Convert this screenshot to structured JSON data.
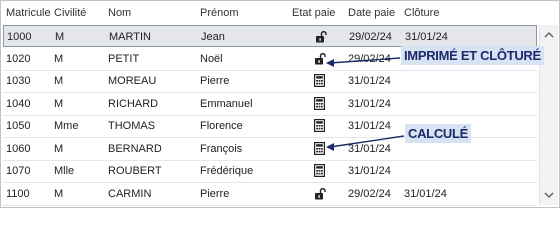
{
  "columns": {
    "matricule": "Matricule",
    "civilite": "Civilité",
    "nom": "Nom",
    "prenom": "Prénom",
    "etat_paie": "Etat paie",
    "date_paie": "Date paie",
    "cloture": "Clôture"
  },
  "rows": [
    {
      "matricule": "1000",
      "civilite": "M",
      "nom": "MARTIN",
      "prenom": "Jean",
      "etat": "lock-icon",
      "date_paie": "29/02/24",
      "cloture": "31/01/24",
      "selected": true
    },
    {
      "matricule": "1020",
      "civilite": "M",
      "nom": "PETIT",
      "prenom": "Noël",
      "etat": "lock-icon",
      "date_paie": "29/02/24",
      "cloture": ""
    },
    {
      "matricule": "1030",
      "civilite": "M",
      "nom": "MOREAU",
      "prenom": "Pierre",
      "etat": "calculator-icon",
      "date_paie": "31/01/24",
      "cloture": ""
    },
    {
      "matricule": "1040",
      "civilite": "M",
      "nom": "RICHARD",
      "prenom": "Emmanuel",
      "etat": "calculator-icon",
      "date_paie": "31/01/24",
      "cloture": ""
    },
    {
      "matricule": "1050",
      "civilite": "Mme",
      "nom": "THOMAS",
      "prenom": "Florence",
      "etat": "calculator-icon",
      "date_paie": "31/01/24",
      "cloture": ""
    },
    {
      "matricule": "1060",
      "civilite": "M",
      "nom": "BERNARD",
      "prenom": "François",
      "etat": "calculator-icon",
      "date_paie": "31/01/24",
      "cloture": ""
    },
    {
      "matricule": "1070",
      "civilite": "Mlle",
      "nom": "ROUBERT",
      "prenom": "Frédérique",
      "etat": "calculator-icon",
      "date_paie": "31/01/24",
      "cloture": ""
    },
    {
      "matricule": "1100",
      "civilite": "M",
      "nom": "CARMIN",
      "prenom": "Pierre",
      "etat": "lock-icon",
      "date_paie": "29/02/24",
      "cloture": "31/01/24"
    }
  ],
  "annotations": {
    "printed_closed": "IMPRIMÉ ET CLÔTURÉ",
    "calculated": "CALCULÉ"
  },
  "colors": {
    "annotation_bg": "#d7e3f2",
    "annotation_text": "#1b2a6b",
    "selection_bg": "#e4e6ea",
    "arrow": "#1b2a6b"
  }
}
